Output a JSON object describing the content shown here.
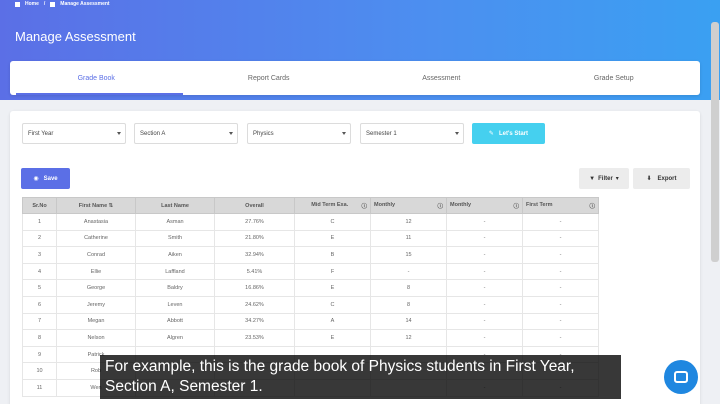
{
  "breadcrumb": {
    "home": "Home",
    "current": "Manage Assessment"
  },
  "page_title": "Manage Assessment",
  "tabs": [
    {
      "label": "Grade Book",
      "active": true
    },
    {
      "label": "Report Cards",
      "active": false
    },
    {
      "label": "Assessment",
      "active": false
    },
    {
      "label": "Grade Setup",
      "active": false
    }
  ],
  "filters": {
    "year": "First Year",
    "section": "Section A",
    "subject": "Physics",
    "semester": "Semester 1",
    "start_label": "Let's Start"
  },
  "toolbar": {
    "save_label": "Save",
    "filter_label": "Filter",
    "export_label": "Export"
  },
  "table": {
    "headers": [
      "Sr.No",
      "First Name",
      "Last Name",
      "Overall",
      "Mid Term Exa.",
      "Monthly",
      "Monthly",
      "First Term"
    ],
    "rows": [
      [
        "1",
        "Anastasia",
        "Asman",
        "27.76%",
        "C",
        "12",
        "-",
        "-"
      ],
      [
        "2",
        "Catherine",
        "Smith",
        "21.80%",
        "E",
        "11",
        "-",
        "-"
      ],
      [
        "3",
        "Conrad",
        "Aiken",
        "32.94%",
        "B",
        "15",
        "-",
        "-"
      ],
      [
        "4",
        "Ellie",
        "Laffland",
        "5.41%",
        "F",
        "-",
        "-",
        "-"
      ],
      [
        "5",
        "George",
        "Baldry",
        "16.86%",
        "E",
        "8",
        "-",
        "-"
      ],
      [
        "6",
        "Jeremy",
        "Leven",
        "24.62%",
        "C",
        "8",
        "-",
        "-"
      ],
      [
        "7",
        "Megan",
        "Abbott",
        "34.27%",
        "A",
        "14",
        "-",
        "-"
      ],
      [
        "8",
        "Nelson",
        "Algren",
        "23.53%",
        "E",
        "12",
        "-",
        "-"
      ],
      [
        "9",
        "Patrick",
        "",
        "",
        "",
        "",
        "-",
        "-"
      ],
      [
        "10",
        "Rob",
        "",
        "",
        "",
        "",
        "-",
        "-"
      ],
      [
        "11",
        "Wen",
        "",
        "",
        "",
        "",
        "-",
        "-"
      ]
    ]
  },
  "subtitle": "For example, this is the grade book of Physics students in First Year, Section A, Semester 1.",
  "colors": {
    "accent": "#5b6fe6",
    "start_button": "#45d0ef",
    "chat": "#1f87e0"
  }
}
